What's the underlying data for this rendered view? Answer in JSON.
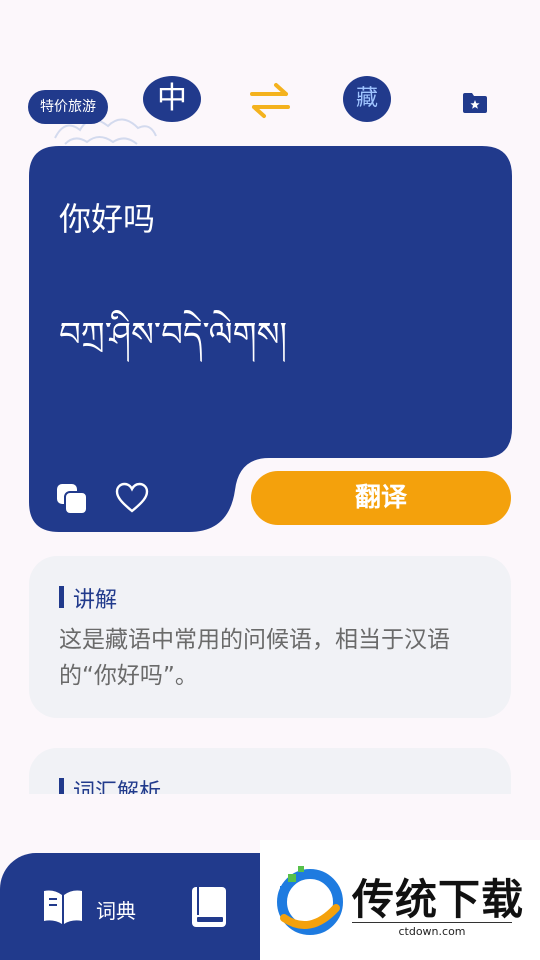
{
  "topbar": {
    "promo_label": "特价旅游",
    "source_lang": "中",
    "target_lang": "藏",
    "swap_icon": "swap-arrows-icon",
    "saved_icon": "star-folder-icon"
  },
  "card": {
    "source_text": "你好吗",
    "target_text": "བཀྲ་ཤིས་བདེ་ལེགས།",
    "copy_icon": "copy-icon",
    "favorite_icon": "heart-icon",
    "translate_label": "翻译"
  },
  "explanation": {
    "title": "讲解",
    "body": "这是藏语中常用的问候语，相当于汉语的“你好吗”。"
  },
  "vocabulary": {
    "title": "词汇解析"
  },
  "bottom_nav": {
    "dict_label": "词典",
    "dict_icon": "open-book-icon",
    "book_icon": "book-icon"
  },
  "watermark": {
    "title": "传统下载",
    "url": "ctdown.com"
  },
  "colors": {
    "primary": "#213a8c",
    "accent": "#f4a10c",
    "background": "#fcf7fb",
    "panel": "#f1f2f6"
  }
}
